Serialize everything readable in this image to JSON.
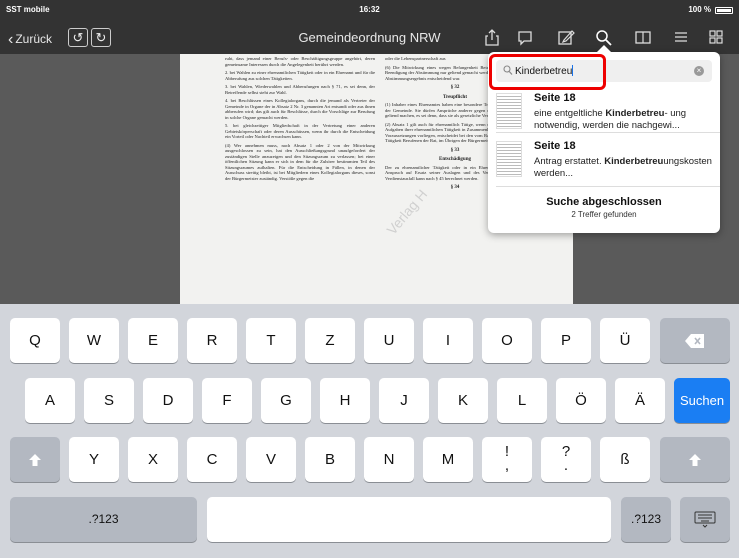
{
  "status_bar": {
    "carrier": "SST mobile",
    "time": "16:32",
    "battery": "100 %"
  },
  "nav": {
    "back_label": "Zurück",
    "title": "Gemeindeordnung NRW",
    "undo_glyph": "↺",
    "redo_glyph": "↻",
    "icons": [
      "share-icon",
      "chat-icon",
      "edit-icon",
      "search-icon",
      "book-icon",
      "list-icon",
      "grid-icon"
    ]
  },
  "document": {
    "left_column": [
      "ruht, dass jemand einer Berufs- oder Beschäftigungsgruppe angehört, deren gemeinsame Interessen durch die Angelegenheit berührt werden.",
      "2. bei Wahlen zu einer ehrenamtlichen Tätigkeit oder in ein Ehrenamt und für die Abberufung aus solchen Tätigkeiten.",
      "3. bei Wahlen, Wiederwahlen und Abberufungen nach § 71, es sei denn, der Betreffende selbst steht zur Wahl.",
      "4. bei Beschlüssen eines Kollegialorgans, durch die jemand als Vertreter der Gemeinde in Organe der in Absatz 2 Nr. 3 genannten Art entsandt oder aus ihnen abberufen wird; das gilt auch für Beschlüsse, durch die Vorschläge zur Berufung in solche Organe gemacht werden.",
      "5. bei gleichzeitiger Mitgliedschaft in der Vertretung einer anderen Gebietskörperschaft oder deren Ausschüssen, wenn ihr durch die Entscheidung ein Vorteil oder Nachteil erwachsen kann.",
      "(4) Wer annehmen muss, nach Absatz 1 oder 2 von der Mitwirkung ausgeschlossen zu sein, hat den Ausschließungsgrund unaufgefordert der zuständigen Stelle anzuzeigen und den Sitzungsraum zu verlassen; bei einer öffentlichen Sitzung kann er sich in dem für die Zuhörer bestimmten Teil des Sitzungsraumes aufhalten. Für die Entscheidung in Fällen, in denen der Ausschuss streitig bleibt, ist bei Mitgliedern eines Kollegialorgans dieses, sonst der Bürgermeister zuständig. Verstöße gegen die"
    ],
    "right_column": [
      "oder die Lebenspartnerschaft aus",
      "(6) Die Mitwirkung eines wegen Befangenheit Betroffenen kann nach Beendigung der Abstimmung nur geltend gemacht werden, wenn sie für das Abstimmungsergebnis entscheidend war.",
      "§ 32",
      "Treupflicht",
      "(1) Inhaber eines Ehrenamtes haben eine besondere Treupflicht gegenüber der Gemeinde. Sie dürfen Ansprüche anderer gegen die Gemeinde nicht geltend machen, es sei denn, dass sie als gesetzliche Vertreter handeln.",
      "(2) Absatz 1 gilt auch für ehrenamtlich Tätige, wenn der Auftrag mit den Aufgaben ihrer ehrenamtlichen Tätigkeit in Zusammenhang steht. Ob diese Voraussetzungen vorliegen, entscheidet bei den vom Rat zu ehrenamtlicher Tätigkeit Berufenen der Rat, im Übrigen der Bürgermeister.",
      "§ 33",
      "Entschädigung",
      "Der zu ehrenamtlicher Tätigkeit oder in ein Ehrenamt Berufene hat Anspruch auf Ersatz seiner Auslagen und des Verdienstausfalls. Der Verdienstausfall kann nach § 45 berechnet werden.",
      "§ 34"
    ],
    "watermark": "Verlag H"
  },
  "search": {
    "query": "Kinderbetreu",
    "results": [
      {
        "page": "Seite 18",
        "pre": "eine entgeltliche ",
        "match": "Kinderbetreu",
        "post": "- ung notwendig, werden die nachgewi..."
      },
      {
        "page": "Seite 18",
        "pre": "Antrag erstattet. ",
        "match": "Kinderbetreu",
        "post": "ungskosten werden..."
      }
    ],
    "status_title": "Suche abgeschlossen",
    "status_detail": "2 Treffer gefunden"
  },
  "keyboard": {
    "row1": [
      "Q",
      "W",
      "E",
      "R",
      "T",
      "Z",
      "U",
      "I",
      "O",
      "P",
      "Ü"
    ],
    "row2": [
      "A",
      "S",
      "D",
      "F",
      "G",
      "H",
      "J",
      "K",
      "L",
      "Ö",
      "Ä"
    ],
    "row3": [
      "Y",
      "X",
      "C",
      "V",
      "B",
      "N",
      "M",
      "!\n,",
      "?\n.",
      "ß"
    ],
    "search_key": "Suchen",
    "numbers_key": ".?123"
  }
}
